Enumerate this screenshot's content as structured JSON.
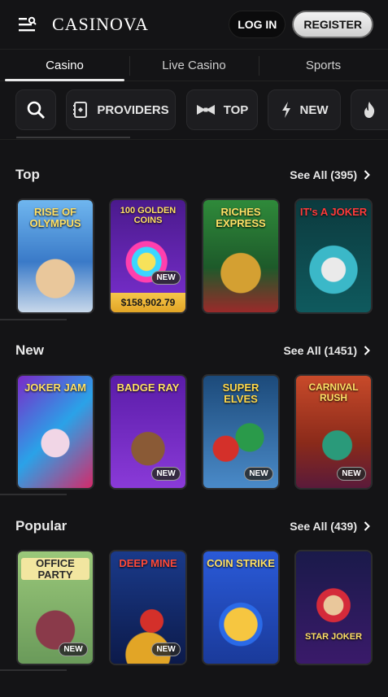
{
  "header": {
    "logo": "CASINOVA",
    "login_label": "LOG IN",
    "register_label": "REGISTER"
  },
  "tabs": [
    {
      "label": "Casino",
      "active": true
    },
    {
      "label": "Live Casino",
      "active": false
    },
    {
      "label": "Sports",
      "active": false
    }
  ],
  "filters": {
    "providers_label": "PROVIDERS",
    "top_label": "TOP",
    "new_label": "NEW"
  },
  "sections": {
    "top": {
      "title": "Top",
      "see_all": "See All (395)",
      "games": [
        {
          "title": "RISE OF OLYMPUS"
        },
        {
          "title": "100 GOLDEN COINS",
          "badge": "NEW",
          "jackpot": "$158,902.79"
        },
        {
          "title": "RICHES EXPRESS"
        },
        {
          "title": "IT's A JOKER"
        }
      ]
    },
    "new": {
      "title": "New",
      "see_all": "See All (1451)",
      "games": [
        {
          "title": "JOKER JAM"
        },
        {
          "title": "BADGE RAY",
          "badge": "NEW"
        },
        {
          "title": "SUPER ELVES",
          "badge": "NEW"
        },
        {
          "title": "CARNIVAL RUSH",
          "badge": "NEW"
        }
      ]
    },
    "popular": {
      "title": "Popular",
      "see_all": "See All (439)",
      "games": [
        {
          "title": "OFFICE PARTY",
          "badge": "NEW"
        },
        {
          "title": "DEEP MINE",
          "badge": "NEW"
        },
        {
          "title": "COIN STRIKE"
        },
        {
          "title": "STAR JOKER"
        }
      ]
    }
  },
  "colors": {
    "background": "#141416",
    "jackpot": "#f0b83a"
  }
}
